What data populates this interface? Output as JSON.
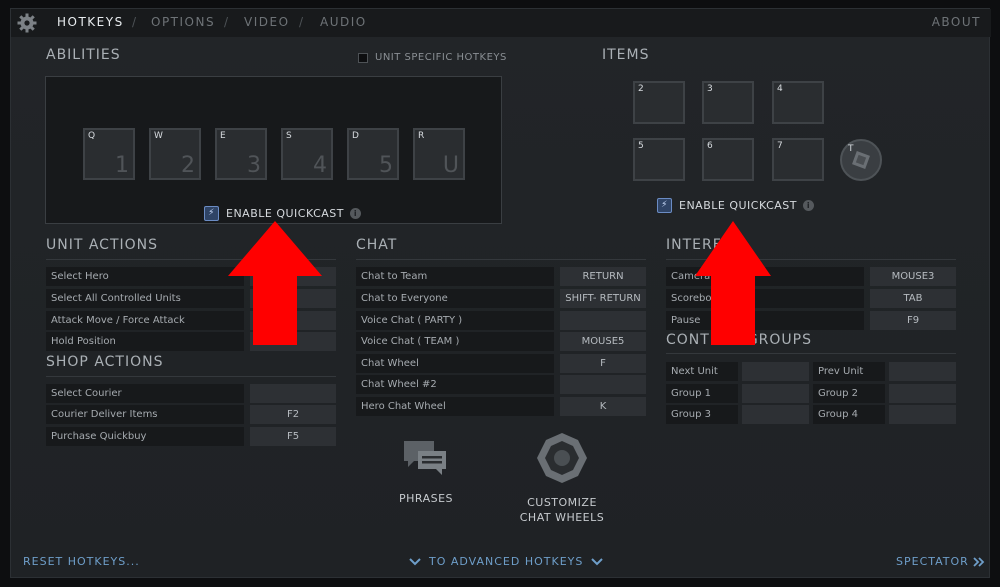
{
  "tabs": [
    {
      "label": "HOTKEYS",
      "active": true
    },
    {
      "label": "OPTIONS",
      "active": false
    },
    {
      "label": "VIDEO",
      "active": false
    },
    {
      "label": "AUDIO",
      "active": false
    }
  ],
  "separator": "/",
  "about_label": "ABOUT",
  "abilities": {
    "title": "ABILITIES",
    "unit_specific_label": "UNIT SPECIFIC HOTKEYS",
    "keys": [
      {
        "key": "Q",
        "number": "1"
      },
      {
        "key": "W",
        "number": "2"
      },
      {
        "key": "E",
        "number": "3"
      },
      {
        "key": "S",
        "number": "4"
      },
      {
        "key": "D",
        "number": "5"
      },
      {
        "key": "R",
        "number": "U"
      }
    ],
    "quickcast_label": "ENABLE QUICKCAST"
  },
  "items": {
    "title": "ITEMS",
    "slots": [
      "2",
      "3",
      "4",
      "5",
      "6",
      "7"
    ],
    "tp_key": "T",
    "quickcast_label": "ENABLE QUICKCAST"
  },
  "unit_actions": {
    "title": "UNIT ACTIONS",
    "rows": [
      {
        "name": "Select Hero",
        "key": "1"
      },
      {
        "name": "Select All Controlled Units",
        "key": ""
      },
      {
        "name": "Attack Move / Force Attack",
        "key": "A"
      },
      {
        "name": "Hold Position",
        "key": ""
      }
    ]
  },
  "shop_actions": {
    "title": "SHOP ACTIONS",
    "rows": [
      {
        "name": "Select Courier",
        "key": ""
      },
      {
        "name": "Courier Deliver Items",
        "key": "F2"
      },
      {
        "name": "Purchase Quickbuy",
        "key": "F5"
      }
    ]
  },
  "chat": {
    "title": "CHAT",
    "rows": [
      {
        "name": "Chat to Team",
        "key": "RETURN"
      },
      {
        "name": "Chat to Everyone",
        "key": "SHIFT- RETURN"
      },
      {
        "name": "Voice Chat ( PARTY )",
        "key": ""
      },
      {
        "name": "Voice Chat ( TEAM )",
        "key": "MOUSE5"
      },
      {
        "name": "Chat Wheel",
        "key": "F"
      },
      {
        "name": "Chat Wheel #2",
        "key": ""
      },
      {
        "name": "Hero Chat Wheel",
        "key": "K"
      }
    ],
    "phrases_label": "PHRASES",
    "customize_line1": "CUSTOMIZE",
    "customize_line2": "CHAT WHEELS"
  },
  "interface": {
    "title": "INTERF",
    "rows": [
      {
        "name": "Camera",
        "key": "MOUSE3"
      },
      {
        "name": "Scoreboa",
        "key": "TAB"
      },
      {
        "name": "Pause",
        "key": "F9"
      }
    ]
  },
  "control_groups": {
    "title": "CONTROL GROUPS",
    "rows": [
      {
        "name": "Next Unit",
        "key": ""
      },
      {
        "name": "Prev Unit",
        "key": ""
      },
      {
        "name": "Group 1",
        "key": ""
      },
      {
        "name": "Group 2",
        "key": ""
      },
      {
        "name": "Group 3",
        "key": ""
      },
      {
        "name": "Group 4",
        "key": ""
      }
    ]
  },
  "footer": {
    "reset_label": "RESET HOTKEYS...",
    "advanced_label": "TO ADVANCED HOTKEYS",
    "spectator_label": "SPECTATOR"
  },
  "colors": {
    "arrow": "#ff0000",
    "link": "#6e9ec9",
    "background": "#222528"
  }
}
